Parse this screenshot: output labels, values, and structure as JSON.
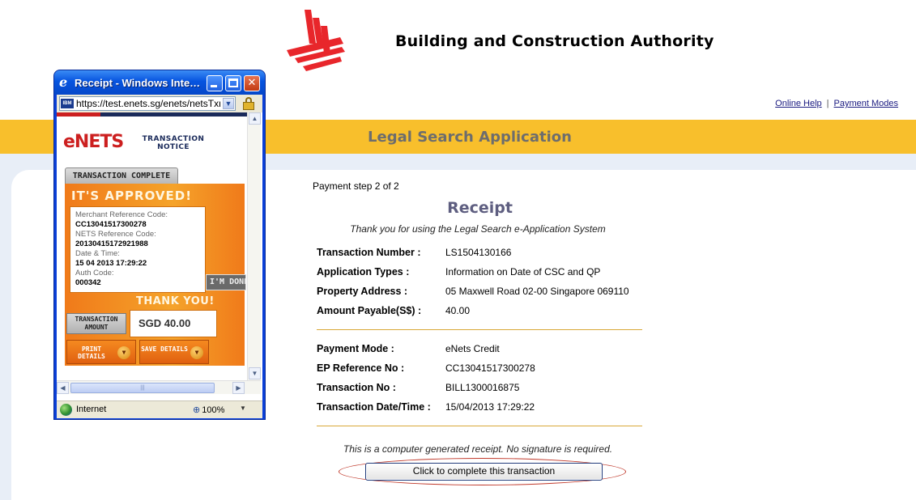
{
  "page": {
    "org_name": "Building and Construction Authority",
    "links": {
      "online_help": "Online Help",
      "separator": "|",
      "payment_modes": "Payment Modes"
    },
    "banner_title": "Legal Search Application",
    "step": "Payment step 2 of 2",
    "receipt_title": "Receipt",
    "thanks": "Thank you for using the Legal Search e-Application System",
    "details": [
      {
        "label": "Transaction Number :",
        "value": "LS1504130166"
      },
      {
        "label": "Application Types :",
        "value": "Information on Date of CSC and QP"
      },
      {
        "label": "Property Address :",
        "value": "05 Maxwell Road 02-00 Singapore 069110"
      },
      {
        "label": "Amount Payable(S$) :",
        "value": "40.00"
      }
    ],
    "payment": [
      {
        "label": "Payment Mode :",
        "value": "eNets Credit"
      },
      {
        "label": "EP Reference No :",
        "value": "CC13041517300278"
      },
      {
        "label": "Transaction No :",
        "value": "BILL1300016875"
      },
      {
        "label": "Transaction Date/Time :",
        "value": "15/04/2013 17:29:22"
      }
    ],
    "disclaimer": "This is a computer generated receipt. No signature is required.",
    "complete_button": "Click to complete this transaction",
    "colors": {
      "banner": "#f8bf2c",
      "logo_red": "#e8262b",
      "title_gray": "#6d6d6d",
      "divider": "#d8a838",
      "annotation_oval": "#c0392b"
    }
  },
  "popup": {
    "title": "Receipt - Windows Internet Explorer",
    "address": "https://test.enets.sg/enets/netsTxn",
    "address_icon_text": "IBM",
    "status_zone": "Internet",
    "zoom": "100%",
    "enets": {
      "logo_e": "e",
      "logo_nets": "NETS",
      "notice": "TRANSACTION NOTICE",
      "tab": "TRANSACTION COMPLETE",
      "approved": "IT'S APPROVED!",
      "fields": [
        {
          "label": "Merchant Reference Code:",
          "value": "CC13041517300278"
        },
        {
          "label": "NETS Reference Code:",
          "value": "20130415172921988"
        },
        {
          "label": "Date & Time:",
          "value": "15 04 2013 17:29:22"
        },
        {
          "label": "Auth Code:",
          "value": "000342"
        }
      ],
      "thank_you": "THANK YOU!",
      "amount_label": "TRANSACTION AMOUNT",
      "amount_value": "SGD 40.00",
      "print_button": "PRINT DETAILS",
      "save_button": "SAVE DETAILS",
      "done_button": "I'M DONE"
    },
    "icons": [
      "ie-icon",
      "minimize-icon",
      "maximize-icon",
      "close-icon",
      "lock-icon",
      "globe-icon",
      "zoom-icon"
    ]
  }
}
